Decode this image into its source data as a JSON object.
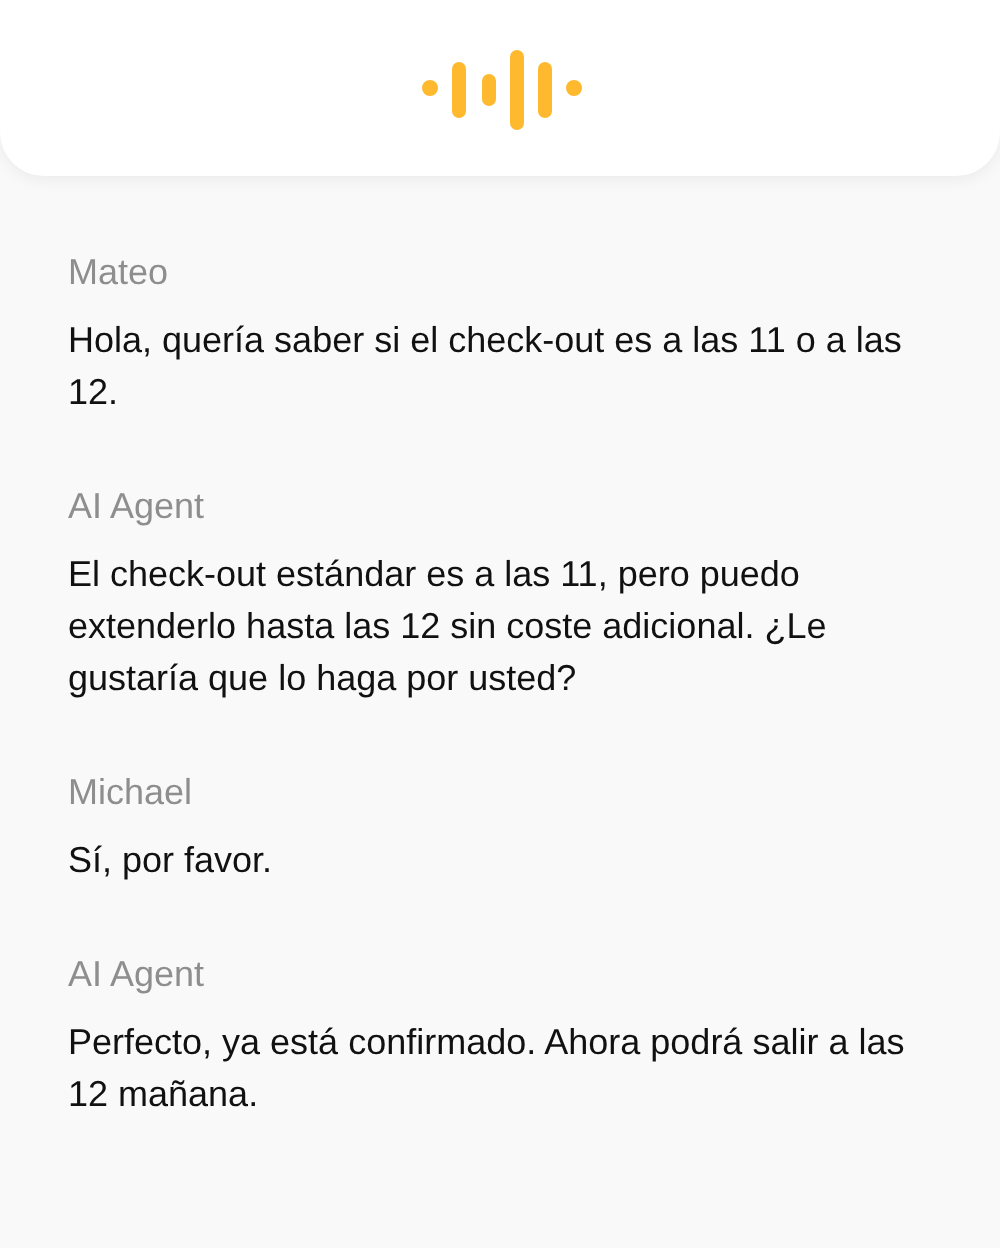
{
  "messages": [
    {
      "speaker": "Mateo",
      "text": "Hola, quería saber si el check-out es a las 11 o a las 12."
    },
    {
      "speaker": "AI Agent",
      "text": "El check-out estándar es a las 11, pero puedo extenderlo hasta las 12 sin coste adicional. ¿Le gustaría que lo haga por usted?"
    },
    {
      "speaker": "Michael",
      "text": "Sí, por favor."
    },
    {
      "speaker": "AI Agent",
      "text": "Perfecto, ya está confirmado. Ahora podrá salir a las 12 mañana."
    }
  ]
}
